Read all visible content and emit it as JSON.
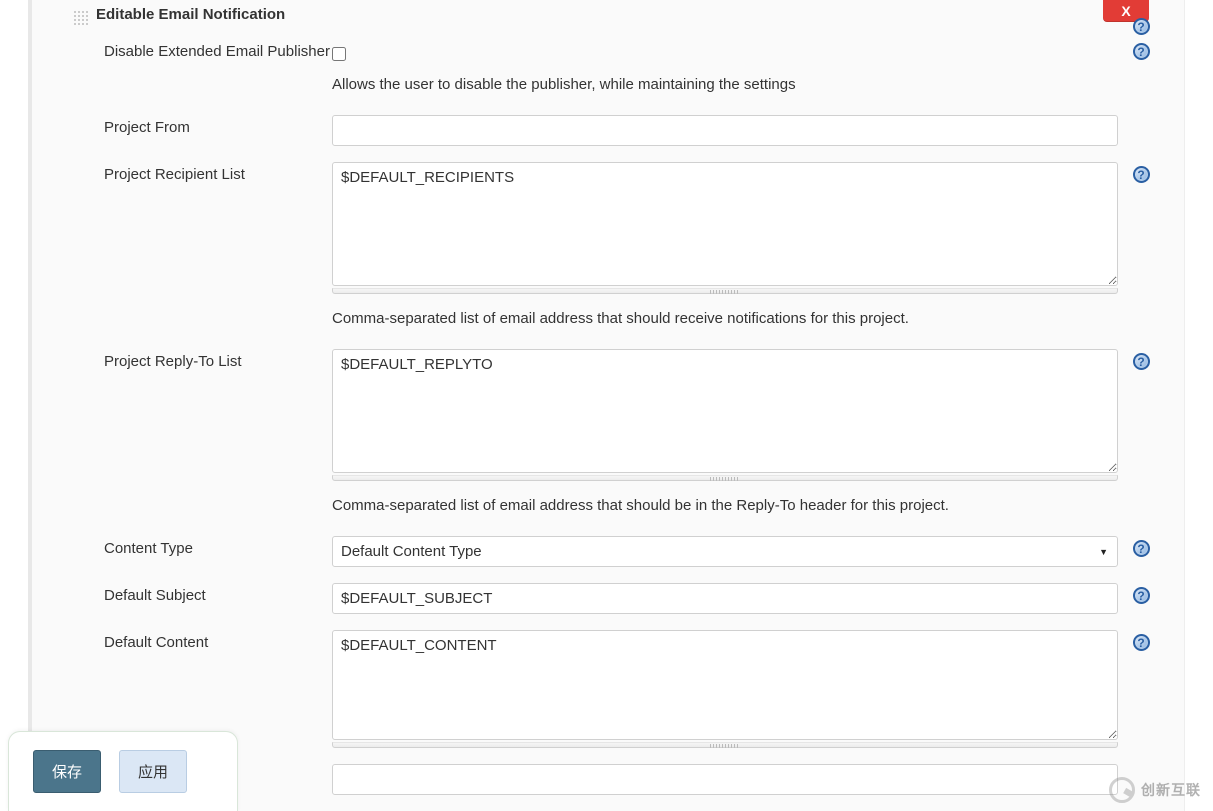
{
  "section": {
    "title": "Editable Email Notification",
    "close_label": "X"
  },
  "fields": {
    "disable_publisher": {
      "label": "Disable Extended Email Publisher",
      "checked": false,
      "hint": "Allows the user to disable the publisher, while maintaining the settings"
    },
    "project_from": {
      "label": "Project From",
      "value": ""
    },
    "recipient_list": {
      "label": "Project Recipient List",
      "value": "$DEFAULT_RECIPIENTS",
      "hint": "Comma-separated list of email address that should receive notifications for this project."
    },
    "reply_to": {
      "label": "Project Reply-To List",
      "value": "$DEFAULT_REPLYTO",
      "hint": "Comma-separated list of email address that should be in the Reply-To header for this project."
    },
    "content_type": {
      "label": "Content Type",
      "selected": "Default Content Type"
    },
    "default_subject": {
      "label": "Default Subject",
      "value": "$DEFAULT_SUBJECT"
    },
    "default_content": {
      "label": "Default Content",
      "value": "$DEFAULT_CONTENT"
    }
  },
  "footer": {
    "save": "保存",
    "apply": "应用"
  },
  "watermark": {
    "text": "创新互联"
  }
}
